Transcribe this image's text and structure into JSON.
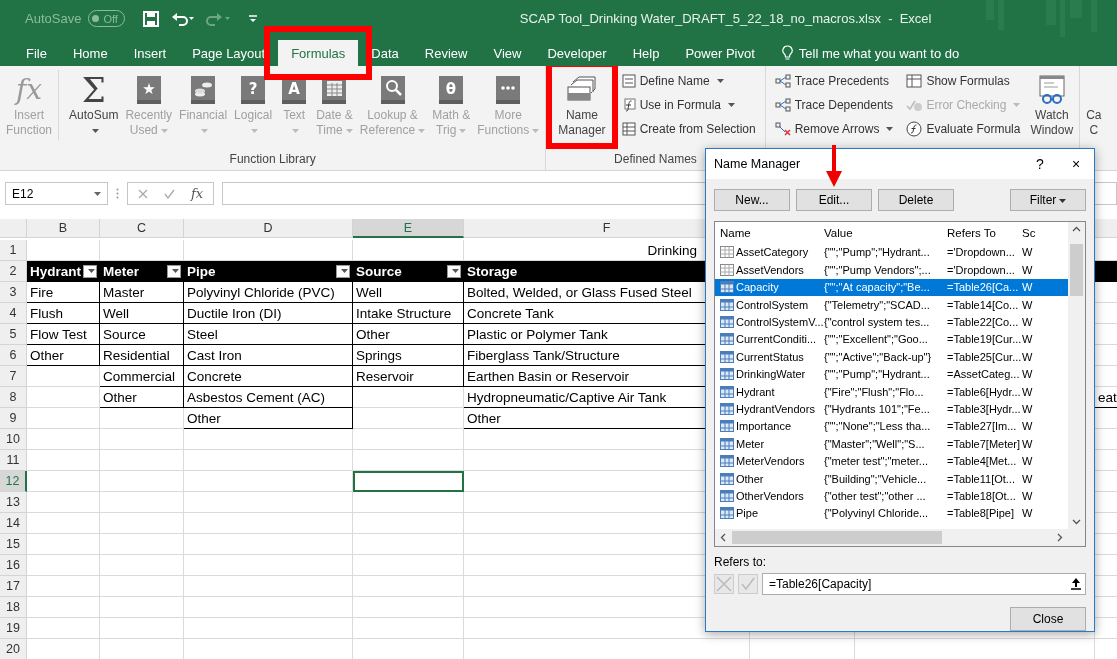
{
  "title_bar": {
    "autosave": {
      "label": "AutoSave",
      "state_text": "Off",
      "on": false
    },
    "title": "SCAP Tool_Drinking Water_DRAFT_5_22_18_no_macros.xlsx  -  Excel"
  },
  "tabs": [
    {
      "label": "File",
      "selected": false,
      "annotated": false
    },
    {
      "label": "Home",
      "selected": false,
      "annotated": false
    },
    {
      "label": "Insert",
      "selected": false,
      "annotated": false
    },
    {
      "label": "Page Layout",
      "selected": false,
      "annotated": false
    },
    {
      "label": "Formulas",
      "selected": true,
      "annotated": true
    },
    {
      "label": "Data",
      "selected": false,
      "annotated": false
    },
    {
      "label": "Review",
      "selected": false,
      "annotated": false
    },
    {
      "label": "View",
      "selected": false,
      "annotated": false
    },
    {
      "label": "Developer",
      "selected": false,
      "annotated": false
    },
    {
      "label": "Help",
      "selected": false,
      "annotated": false
    },
    {
      "label": "Power Pivot",
      "selected": false,
      "annotated": false
    }
  ],
  "tell_me": {
    "placeholder": "Tell me what you want to do"
  },
  "ribbon": {
    "groups": [
      {
        "label": "Function Library",
        "items": [
          {
            "kind": "large",
            "label": "Insert\nFunction",
            "glyph": "fx",
            "disabled": true,
            "dropdown": false,
            "annotated": false
          },
          {
            "kind": "large",
            "label": "AutoSum",
            "glyph": "Σ",
            "disabled": false,
            "dropdown": true,
            "annotated": false
          },
          {
            "kind": "large",
            "label": "Recently\nUsed",
            "glyph": "★",
            "disabled": true,
            "dropdown": true,
            "annotated": false
          },
          {
            "kind": "large",
            "label": "Financial",
            "disabled": true,
            "dropdown": true,
            "annotated": false
          },
          {
            "kind": "large",
            "label": "Logical",
            "glyph": "?",
            "disabled": true,
            "dropdown": true,
            "annotated": false
          },
          {
            "kind": "large",
            "label": "Text",
            "glyph": "A",
            "disabled": true,
            "dropdown": true,
            "annotated": false
          },
          {
            "kind": "large",
            "label": "Date &\nTime",
            "disabled": true,
            "dropdown": true,
            "annotated": false
          },
          {
            "kind": "large",
            "label": "Lookup &\nReference",
            "disabled": true,
            "dropdown": true,
            "annotated": false
          },
          {
            "kind": "large",
            "label": "Math &\nTrig",
            "glyph": "θ",
            "disabled": true,
            "dropdown": true,
            "annotated": false
          },
          {
            "kind": "large",
            "label": "More\nFunctions",
            "disabled": true,
            "dropdown": true,
            "annotated": false
          }
        ]
      },
      {
        "label": "Defined Names",
        "items": [
          {
            "kind": "large",
            "label": "Name\nManager",
            "disabled": false,
            "dropdown": false,
            "annotated": true
          },
          {
            "kind": "stack",
            "items": [
              {
                "label": "Define Name",
                "disabled": false,
                "dropdown": true
              },
              {
                "label": "Use in Formula",
                "disabled": false,
                "dropdown": true
              },
              {
                "label": "Create from Selection",
                "disabled": false,
                "dropdown": false
              }
            ]
          }
        ]
      },
      {
        "items": [
          {
            "kind": "stack",
            "items": [
              {
                "label": "Trace Precedents",
                "disabled": false,
                "dropdown": false
              },
              {
                "label": "Trace Dependents",
                "disabled": false,
                "dropdown": false
              },
              {
                "label": "Remove Arrows",
                "disabled": false,
                "dropdown": true
              }
            ]
          },
          {
            "kind": "stack",
            "items": [
              {
                "label": "Show Formulas",
                "disabled": false,
                "dropdown": false
              },
              {
                "label": "Error Checking",
                "disabled": true,
                "dropdown": true
              },
              {
                "label": "Evaluate Formula",
                "disabled": false,
                "dropdown": false
              }
            ]
          },
          {
            "kind": "large",
            "label": "Watch\nWindow",
            "disabled": false,
            "dropdown": false,
            "annotated": false
          }
        ]
      },
      {
        "items": [
          {
            "kind": "large",
            "label": "Ca\nC",
            "disabled": false,
            "dropdown": false,
            "annotated": false
          }
        ]
      }
    ]
  },
  "formula_bar": {
    "name_box": "E12",
    "fx": "fx"
  },
  "sheet": {
    "columns": [
      {
        "label": "B",
        "selected": false
      },
      {
        "label": "C",
        "selected": false
      },
      {
        "label": "D",
        "selected": false
      },
      {
        "label": "E",
        "selected": true
      },
      {
        "label": "F",
        "selected": false
      }
    ],
    "rows": [
      {
        "number": "1",
        "selected": false,
        "kind": "title",
        "cells": [
          null,
          null,
          null,
          null,
          "Drinking"
        ]
      },
      {
        "number": "2",
        "selected": false,
        "kind": "header",
        "cells": [
          {
            "text": "Hydrant",
            "filter": true
          },
          {
            "text": "Meter",
            "filter": true
          },
          {
            "text": "Pipe",
            "filter": true
          },
          {
            "text": "Source",
            "filter": true
          },
          {
            "text": "Storage"
          }
        ]
      },
      {
        "number": "3",
        "selected": false,
        "kind": "data",
        "cells": [
          "Fire",
          "Master",
          "Polyvinyl Chloride (PVC)",
          "Well",
          "Bolted, Welded, or Glass Fused Steel"
        ]
      },
      {
        "number": "4",
        "selected": false,
        "kind": "data",
        "cells": [
          "Flush",
          "Well",
          "Ductile Iron (DI)",
          "Intake Structure",
          "Concrete Tank"
        ]
      },
      {
        "number": "5",
        "selected": false,
        "kind": "data",
        "cells": [
          "Flow Test",
          "Source",
          "Steel",
          "Other",
          "Plastic or Polymer Tank"
        ]
      },
      {
        "number": "6",
        "selected": false,
        "kind": "data",
        "cells": [
          "Other",
          "Residential",
          "Cast Iron",
          "Springs",
          "Fiberglass Tank/Structure"
        ]
      },
      {
        "number": "7",
        "selected": false,
        "kind": "data",
        "cells": [
          null,
          "Commercial",
          "Concrete",
          "Reservoir",
          "Earthen Basin or Reservoir"
        ]
      },
      {
        "number": "8",
        "selected": false,
        "kind": "data",
        "cells": [
          null,
          "Other",
          "Asbestos Cement (AC)",
          null,
          "Hydropneumatic/Captive Air Tank"
        ],
        "edge_cell": "eat"
      },
      {
        "number": "9",
        "selected": false,
        "kind": "data",
        "cells": [
          null,
          null,
          "Other",
          null,
          "Other"
        ]
      },
      {
        "number": "10",
        "selected": false,
        "kind": "blank"
      },
      {
        "number": "11",
        "selected": false,
        "kind": "blank"
      },
      {
        "number": "12",
        "selected": true,
        "kind": "blank"
      },
      {
        "number": "13",
        "selected": false,
        "kind": "blank"
      },
      {
        "number": "14",
        "selected": false,
        "kind": "blank"
      },
      {
        "number": "15",
        "selected": false,
        "kind": "blank"
      },
      {
        "number": "16",
        "selected": false,
        "kind": "blank"
      },
      {
        "number": "17",
        "selected": false,
        "kind": "blank"
      },
      {
        "number": "18",
        "selected": false,
        "kind": "blank"
      },
      {
        "number": "19",
        "selected": false,
        "kind": "blank"
      },
      {
        "number": "20",
        "selected": false,
        "kind": "blank"
      }
    ]
  },
  "name_manager": {
    "title": "Name Manager",
    "help": "?",
    "close": "×",
    "buttons": [
      {
        "label": "New...",
        "kind": "plain",
        "annotated": false
      },
      {
        "label": "Edit...",
        "kind": "plain",
        "annotated": true
      },
      {
        "label": "Delete",
        "kind": "plain",
        "annotated": false
      },
      {
        "label": "Filter",
        "kind": "dropdown",
        "annotated": false
      }
    ],
    "columns": [
      "Name",
      "Value",
      "Refers To",
      "Sc"
    ],
    "rows": [
      {
        "kind": "range",
        "name": "AssetCategory",
        "value": "{\"\";\"Pump\";\"Hydrant...",
        "refers_to": "='Dropdown...",
        "scope": "W",
        "selected": false
      },
      {
        "kind": "range",
        "name": "AssetVendors",
        "value": "{\"\";\"Pump Vendors\";...",
        "refers_to": "='Dropdown...",
        "scope": "W",
        "selected": false
      },
      {
        "kind": "table",
        "name": "Capacity",
        "value": "{\"\";\"At capacity\";\"Be...",
        "refers_to": "=Table26[Ca...",
        "scope": "W",
        "selected": true
      },
      {
        "kind": "table",
        "name": "ControlSystem",
        "value": "{\"Telemetry\";\"SCAD...",
        "refers_to": "=Table14[Co...",
        "scope": "W",
        "selected": false
      },
      {
        "kind": "table",
        "name": "ControlSystemV...",
        "value": "{\"control system tes...",
        "refers_to": "=Table22[Co...",
        "scope": "W",
        "selected": false
      },
      {
        "kind": "table",
        "name": "CurrentConditi...",
        "value": "{\"\";\"Excellent\";\"Goo...",
        "refers_to": "=Table19[Cur...",
        "scope": "W",
        "selected": false
      },
      {
        "kind": "table",
        "name": "CurrentStatus",
        "value": "{\"\";\"Active\";\"Back-up\"}",
        "refers_to": "=Table25[Cur...",
        "scope": "W",
        "selected": false
      },
      {
        "kind": "table",
        "name": "DrinkingWater",
        "value": "{\"\";\"Pump\";\"Hydrant...",
        "refers_to": "=AssetCateg...",
        "scope": "W",
        "selected": false
      },
      {
        "kind": "table",
        "name": "Hydrant",
        "value": "{\"Fire\";\"Flush\";\"Flo...",
        "refers_to": "=Table6[Hydr...",
        "scope": "W",
        "selected": false
      },
      {
        "kind": "table",
        "name": "HydrantVendors",
        "value": "{\"Hydrants 101\";\"Fe...",
        "refers_to": "=Table3[Hydr...",
        "scope": "W",
        "selected": false
      },
      {
        "kind": "table",
        "name": "Importance",
        "value": "{\"\";\"None\";\"Less tha...",
        "refers_to": "=Table27[Im...",
        "scope": "W",
        "selected": false
      },
      {
        "kind": "table",
        "name": "Meter",
        "value": "{\"Master\";\"Well\";\"S...",
        "refers_to": "=Table7[Meter]",
        "scope": "W",
        "selected": false
      },
      {
        "kind": "table",
        "name": "MeterVendors",
        "value": "{\"meter test\";\"meter...",
        "refers_to": "=Table4[Met...",
        "scope": "W",
        "selected": false
      },
      {
        "kind": "table",
        "name": "Other",
        "value": "{\"Building\";\"Vehicle...",
        "refers_to": "=Table11[Ot...",
        "scope": "W",
        "selected": false
      },
      {
        "kind": "table",
        "name": "OtherVendors",
        "value": "{\"other test\";\"other ...",
        "refers_to": "=Table18[Ot...",
        "scope": "W",
        "selected": false
      },
      {
        "kind": "table",
        "name": "Pipe",
        "value": "{\"Polyvinyl Chloride...",
        "refers_to": "=Table8[Pipe]",
        "scope": "W",
        "selected": false
      }
    ],
    "refers_to_label": "Refers to:",
    "refers_to_value": "=Table26[Capacity]",
    "close_button": "Close"
  }
}
